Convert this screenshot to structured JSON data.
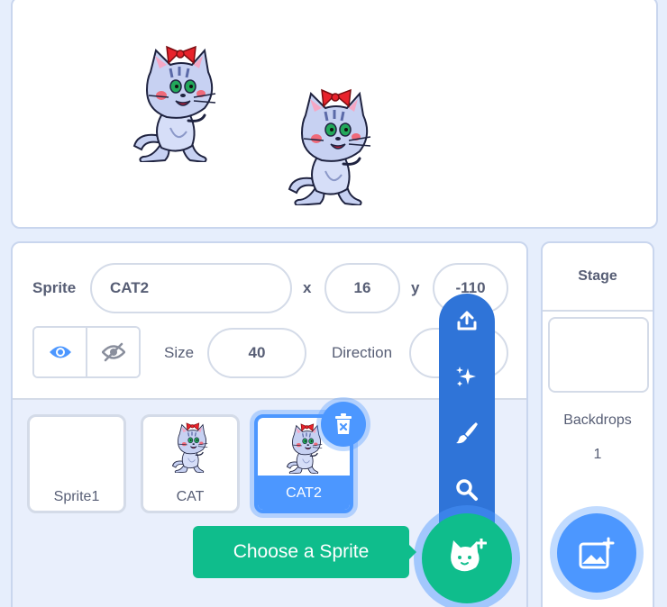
{
  "stage": {
    "sprites": [
      "cat",
      "cat"
    ]
  },
  "sprite_info": {
    "sprite_label": "Sprite",
    "sprite_name": "CAT2",
    "x_label": "x",
    "x_value": "16",
    "y_label": "y",
    "y_value": "-110",
    "show_label": "Show",
    "size_label": "Size",
    "size_value": "40",
    "direction_label": "Direction",
    "direction_value": ""
  },
  "sprite_list": [
    {
      "name": "Sprite1",
      "has_thumb": false,
      "selected": false
    },
    {
      "name": "CAT",
      "has_thumb": true,
      "selected": false
    },
    {
      "name": "CAT2",
      "has_thumb": true,
      "selected": true
    }
  ],
  "stage_pane": {
    "title": "Stage",
    "backdrops_label": "Backdrops",
    "backdrops_count": "1"
  },
  "sprite_menu": {
    "items": [
      "upload-icon",
      "surprise-icon",
      "paint-icon",
      "search-icon"
    ],
    "tooltip": "Choose a Sprite"
  },
  "colors": {
    "accent_blue": "#4c97ff",
    "menu_blue": "#2f74d8",
    "sprite_green": "#0fbd8c"
  }
}
